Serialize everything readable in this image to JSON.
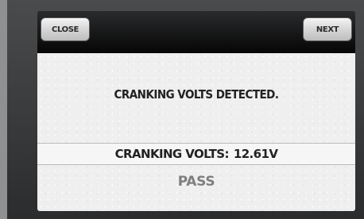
{
  "toolbar": {
    "close_label": "CLOSE",
    "next_label": "NEXT"
  },
  "main": {
    "message": "CRANKING VOLTS DETECTED.",
    "volts_label": "CRANKING VOLTS:",
    "volts_value": "12.61V",
    "result": "PASS"
  },
  "colors": {
    "panel_background": "#efefef",
    "titlebar": "#0a0a0a",
    "result_text": "#7f7f7f"
  }
}
